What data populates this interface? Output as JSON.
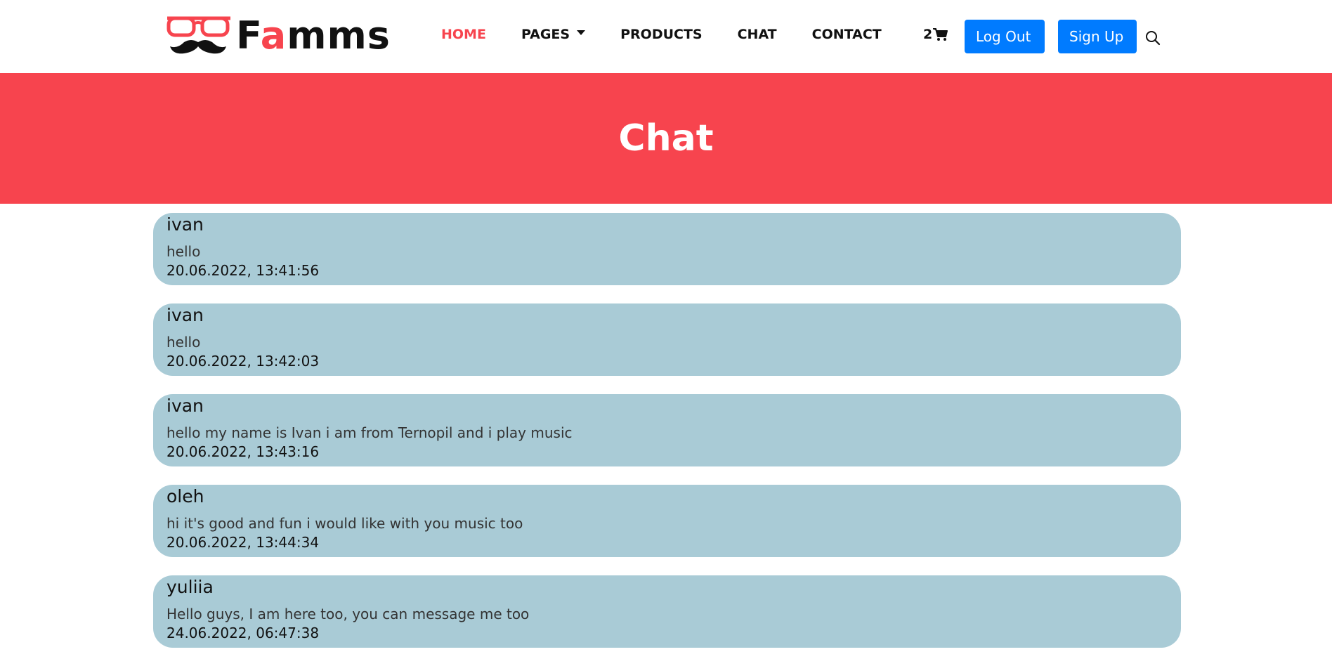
{
  "brand": {
    "prefix": "F",
    "accent": "a",
    "suffix": "mms",
    "accent_color": "#f7444e"
  },
  "nav": {
    "items": [
      {
        "label": "HOME",
        "active": true
      },
      {
        "label": "PAGES",
        "dropdown": true
      },
      {
        "label": "PRODUCTS"
      },
      {
        "label": "CHAT"
      },
      {
        "label": "CONTACT"
      }
    ],
    "cart_count": "2",
    "logout_label": "Log Out",
    "signup_label": "Sign Up",
    "button_color": "#007bff"
  },
  "banner": {
    "title": "Chat",
    "color": "#f7444e"
  },
  "messages": [
    {
      "user": "ivan",
      "text": "hello",
      "time": "20.06.2022, 13:41:56"
    },
    {
      "user": "ivan",
      "text": "hello",
      "time": "20.06.2022, 13:42:03"
    },
    {
      "user": "ivan",
      "text": "hello my name is Ivan i am from Ternopil and i play music",
      "time": "20.06.2022, 13:43:16"
    },
    {
      "user": "oleh",
      "text": "hi it's good and fun i would like with you music too",
      "time": "20.06.2022, 13:44:34"
    },
    {
      "user": "yuliia",
      "text": "Hello guys, I am here too, you can message me too",
      "time": "24.06.2022, 06:47:38"
    }
  ],
  "message_bg": "#a9cbd6"
}
